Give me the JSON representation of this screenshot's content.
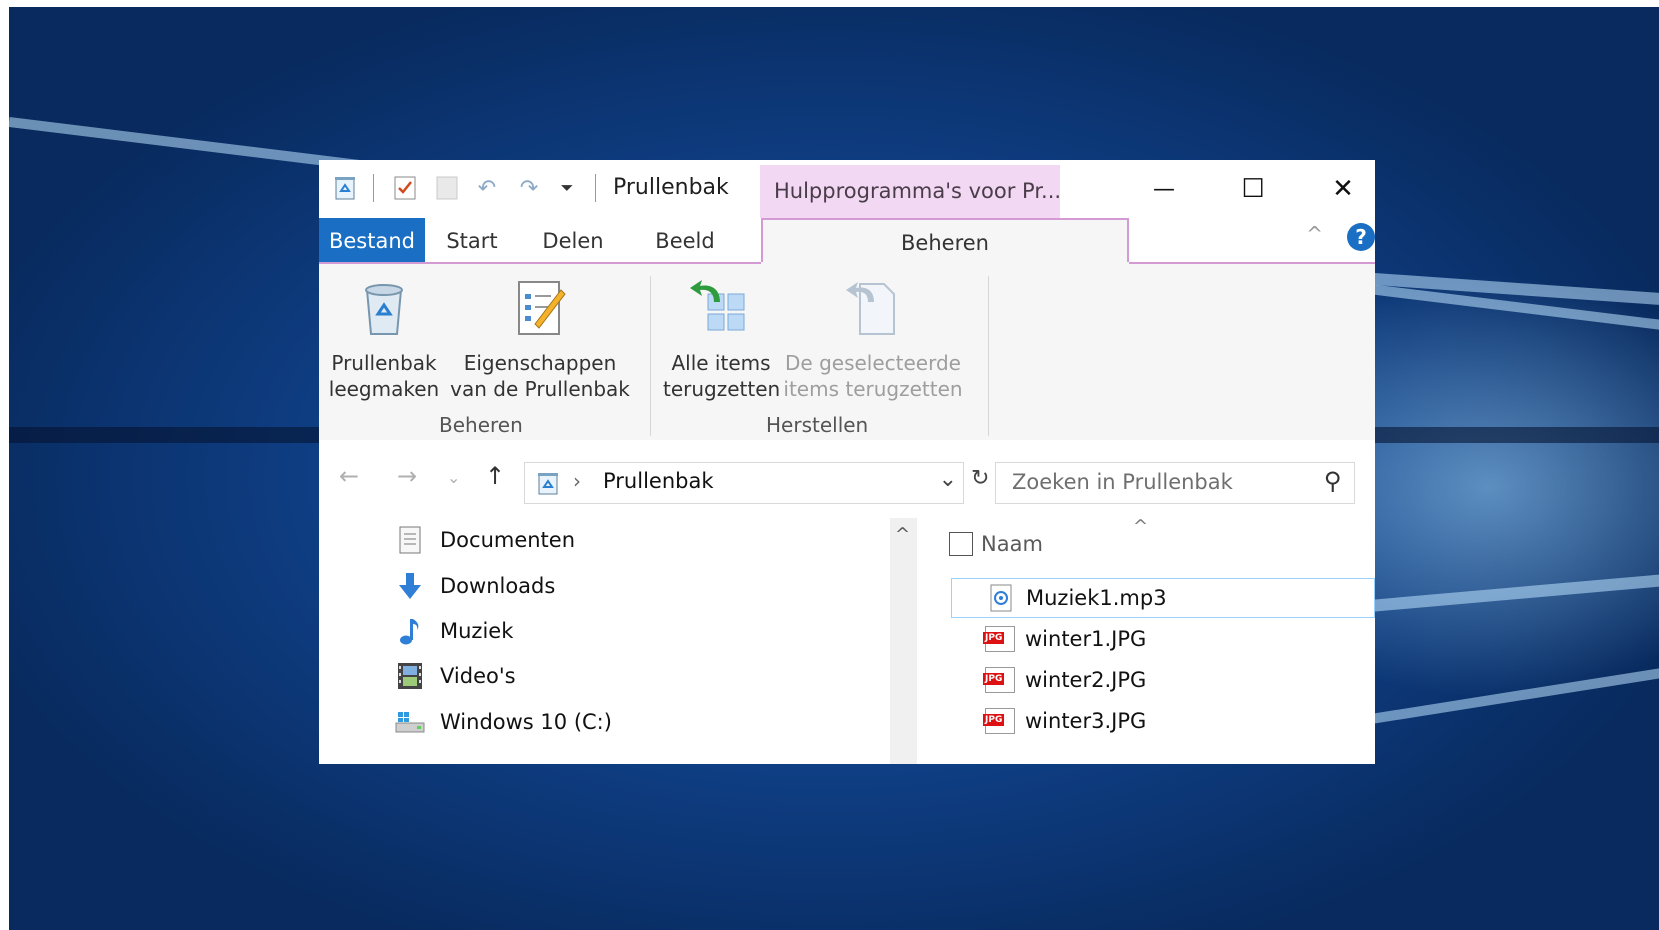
{
  "window": {
    "title": "Prullenbak",
    "context_tab": "Hulpprogramma's voor Pr...",
    "minimize_glyph": "—",
    "maximize_glyph": "☐",
    "close_glyph": "✕"
  },
  "quick_access": {
    "dropdown_glyph": "⏷",
    "undo_glyph": "↶",
    "redo_glyph": "↷"
  },
  "tabs": [
    {
      "label": "Bestand"
    },
    {
      "label": "Start"
    },
    {
      "label": "Delen"
    },
    {
      "label": "Beeld"
    },
    {
      "label": "Beheren"
    }
  ],
  "ribbon": {
    "buttons": [
      {
        "label1": "Prullenbak",
        "label2": "leegmaken",
        "icon": "recycle-bin-icon"
      },
      {
        "label1": "Eigenschappen",
        "label2": "van de Prullenbak",
        "icon": "properties-icon"
      },
      {
        "label1": "Alle items",
        "label2": "terugzetten",
        "icon": "restore-all-icon"
      },
      {
        "label1": "De geselecteerde",
        "label2": "items terugzetten",
        "icon": "restore-selected-icon",
        "disabled": true
      }
    ],
    "groups": [
      "Beheren",
      "Herstellen"
    ]
  },
  "address": {
    "back_glyph": "←",
    "forward_glyph": "→",
    "recent_glyph": "⌄",
    "up_glyph": "↑",
    "path": "Prullenbak",
    "separator": "›",
    "dropdown_glyph": "⌄",
    "refresh_glyph": "↻",
    "search_placeholder": "Zoeken in Prullenbak",
    "search_glyph": "⚲"
  },
  "nav_pane": [
    {
      "label": "Documenten",
      "icon": "documents-icon"
    },
    {
      "label": "Downloads",
      "icon": "downloads-icon"
    },
    {
      "label": "Muziek",
      "icon": "music-icon"
    },
    {
      "label": "Video's",
      "icon": "videos-icon"
    },
    {
      "label": "Windows 10 (C:)",
      "icon": "drive-icon"
    }
  ],
  "file_list": {
    "column_name": "Naam",
    "sort_glyph": "^",
    "files": [
      {
        "name": "Muziek1.mp3",
        "type": "mp3",
        "selected": true
      },
      {
        "name": "winter1.JPG",
        "type": "jpg"
      },
      {
        "name": "winter2.JPG",
        "type": "jpg"
      },
      {
        "name": "winter3.JPG",
        "type": "jpg"
      }
    ],
    "jpg_badge": "JPG"
  },
  "colors": {
    "accent": "#1a6fc4",
    "context_tab": "#f2d8f2",
    "ribbon_bg": "#f6f6f6"
  }
}
